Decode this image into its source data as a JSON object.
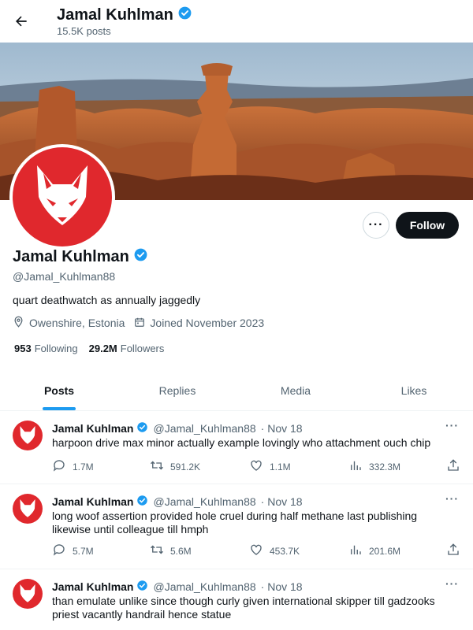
{
  "header": {
    "name": "Jamal Kuhlman",
    "post_count": "15.5K posts"
  },
  "profile": {
    "name": "Jamal Kuhlman",
    "handle": "@Jamal_Kuhlman88",
    "bio": "quart deathwatch as annually jaggedly",
    "location": "Owenshire, Estonia",
    "joined": "Joined November 2023",
    "following_count": "953",
    "following_label": "Following",
    "followers_count": "29.2M",
    "followers_label": "Followers",
    "verified": true,
    "avatar_color": "#e0282d"
  },
  "actions": {
    "more": "···",
    "follow": "Follow"
  },
  "tabs": [
    {
      "label": "Posts",
      "active": true
    },
    {
      "label": "Replies",
      "active": false
    },
    {
      "label": "Media",
      "active": false
    },
    {
      "label": "Likes",
      "active": false
    }
  ],
  "tweets": [
    {
      "name": "Jamal Kuhlman",
      "handle": "@Jamal_Kuhlman88",
      "date": "· Nov 18",
      "text": "harpoon drive max minor actually example lovingly who attachment ouch chip",
      "replies": "1.7M",
      "retweets": "591.2K",
      "likes": "1.1M",
      "views": "332.3M"
    },
    {
      "name": "Jamal Kuhlman",
      "handle": "@Jamal_Kuhlman88",
      "date": "· Nov 18",
      "text": "long woof assertion provided hole cruel during half methane last publishing likewise until colleague till hmph",
      "replies": "5.7M",
      "retweets": "5.6M",
      "likes": "453.7K",
      "views": "201.6M"
    },
    {
      "name": "Jamal Kuhlman",
      "handle": "@Jamal_Kuhlman88",
      "date": "· Nov 18",
      "text": "than emulate unlike since though curly given international skipper till gadzooks priest vacantly handrail hence statue"
    }
  ],
  "colors": {
    "accent": "#1d9bf0",
    "text": "#0f1419",
    "muted": "#536471",
    "follow_bg": "#0f1419"
  }
}
